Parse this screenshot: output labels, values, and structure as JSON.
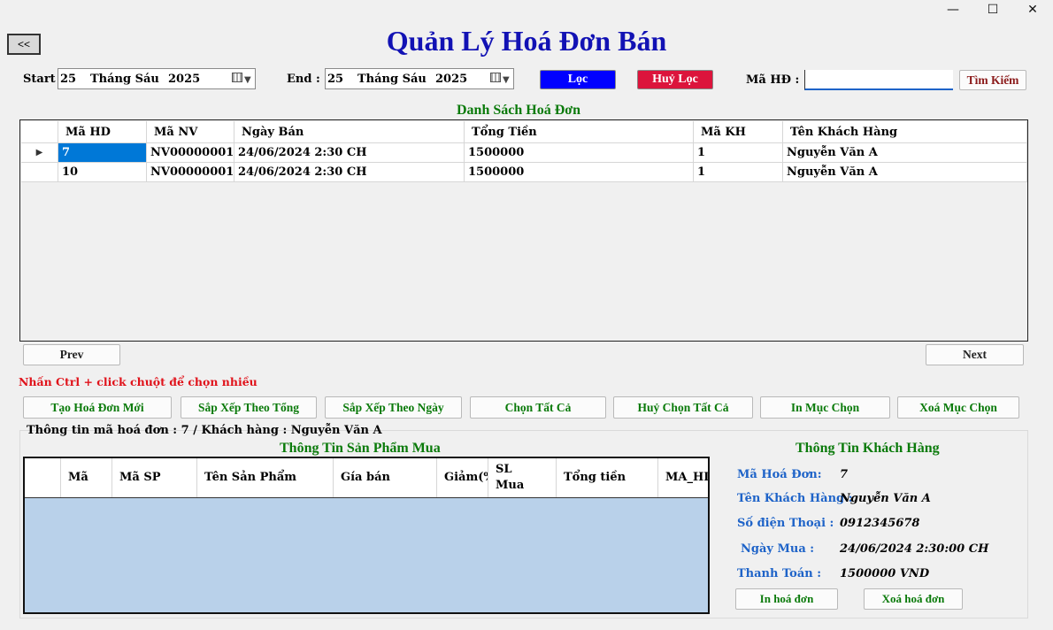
{
  "window": {
    "minimize": "—",
    "maximize": "☐",
    "close": "✕"
  },
  "back_label": "<<",
  "title": "Quản Lý Hoá Đơn Bán",
  "filter": {
    "start_label": "Start :",
    "start": {
      "day": "25",
      "month": "Tháng Sáu",
      "year": "2025"
    },
    "end_label": "End :",
    "end": {
      "day": "25",
      "month": "Tháng Sáu",
      "year": "2025"
    },
    "filter_label": "Lọc",
    "clear_filter_label": "Huỷ Lọc",
    "invoice_id_label": "Mã HĐ :",
    "invoice_id_value": "",
    "search_label": "Tìm Kiếm"
  },
  "invoice_list": {
    "title": "Danh Sách Hoá Đơn",
    "columns": [
      "Mã HD",
      "Mã NV",
      "Ngày Bán",
      "Tổng Tiền",
      "Mã KH",
      "Tên Khách Hàng"
    ],
    "rows": [
      [
        "7",
        "NV00000001...",
        "24/06/2024 2:30 CH",
        "1500000",
        "1",
        "Nguyễn Văn A"
      ],
      [
        "10",
        "NV00000001...",
        "24/06/2024 2:30 CH",
        "1500000",
        "1",
        "Nguyễn Văn A"
      ]
    ],
    "current_row_marker": "▶"
  },
  "pager": {
    "prev_label": "Prev",
    "next_label": "Next"
  },
  "hint": "Nhấn Ctrl + click chuột để chọn nhiều",
  "actions": {
    "create": "Tạo Hoá Đơn Mới",
    "sort_total": "Sắp Xếp Theo Tổng",
    "sort_date": "Sắp Xếp Theo Ngày",
    "select_all": "Chọn Tất Cả",
    "deselect_all": "Huỷ Chọn Tất Cả",
    "print_selected": "In Mục Chọn",
    "delete_selected": "Xoá Mục Chọn"
  },
  "info_line": "Thông tin mã hoá đơn : 7  / Khách hàng : Nguyễn Văn A",
  "products": {
    "title": "Thông Tin Sản Phẩm Mua",
    "columns": [
      "Mã",
      "Mã SP",
      "Tên Sản Phẩm",
      "Gía bán",
      "Giảm(%",
      "SL Mua",
      "Tổng tiền",
      "MA_HD"
    ]
  },
  "customer": {
    "title": "Thông Tin Khách Hàng",
    "invoice_label": "Mã Hoá Đơn:",
    "invoice_value": "7",
    "name_label": "Tên Khách Hàng :",
    "name_value": "Nguyễn Văn A",
    "phone_label": "Số điện Thoại :",
    "phone_value": "0912345678",
    "date_label": "Ngày Mua :",
    "date_value": "24/06/2024 2:30:00 CH",
    "pay_label": "Thanh Toán :",
    "pay_value": "1500000 VND",
    "print_label": "In hoá đơn",
    "delete_label": "Xoá hoá đơn"
  },
  "colors": {
    "title": "#1212b4",
    "green": "#0a7a0a",
    "blue_btn": "#0000ff",
    "red_btn": "#dc143c",
    "selection": "#0078d7",
    "empty_grid": "#b9d1ea"
  }
}
